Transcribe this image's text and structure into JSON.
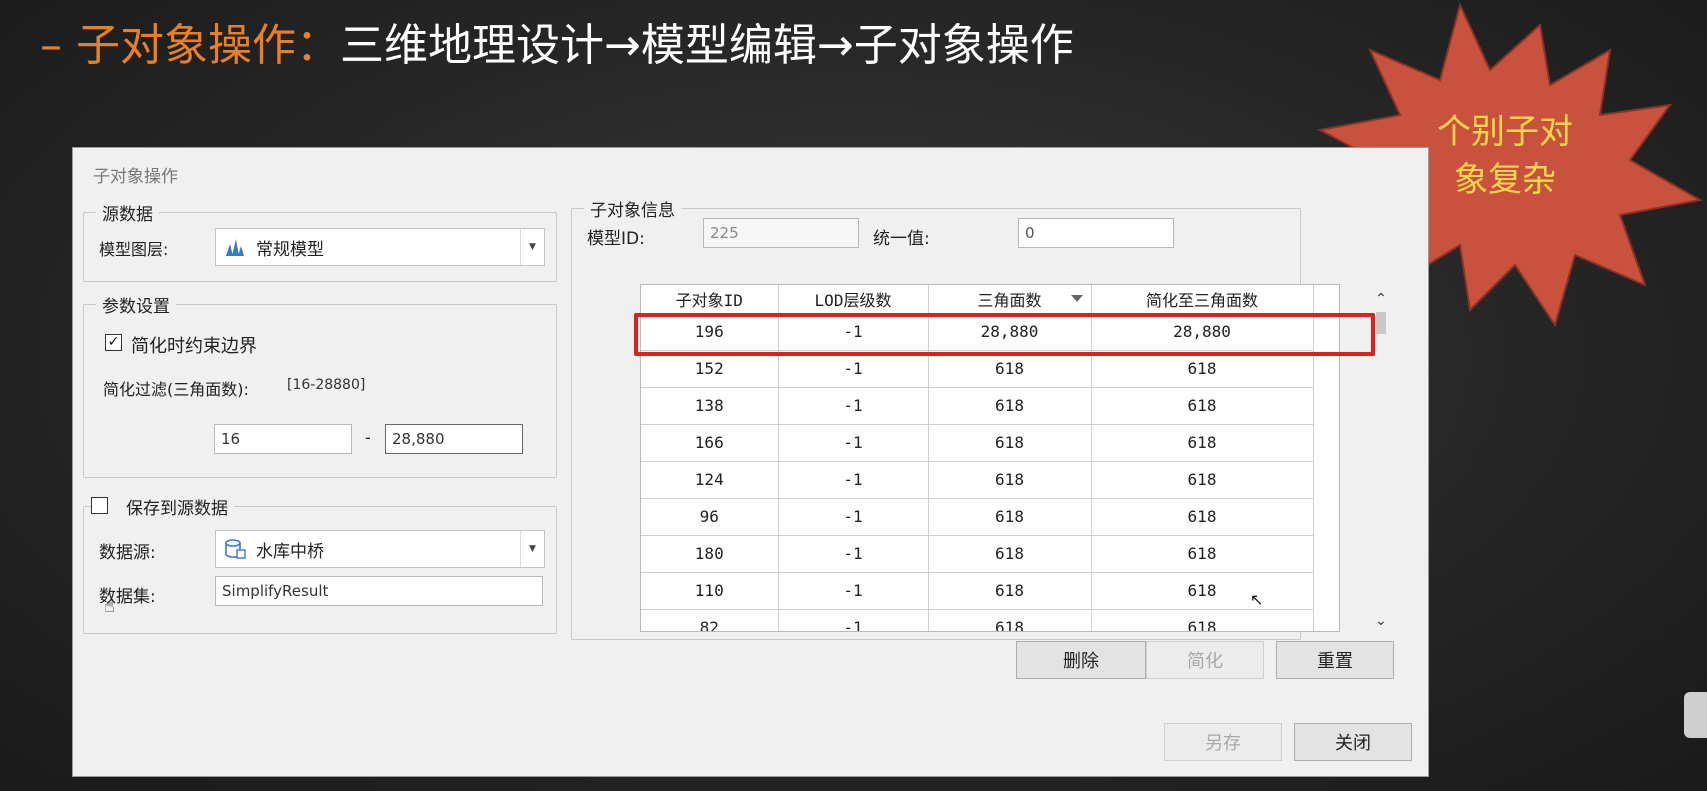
{
  "slide": {
    "title_highlight": "– 子对象操作：",
    "title_rest": "三维地理设计→模型编辑→子对象操作"
  },
  "callout": {
    "line1": "个别子对",
    "line2": "象复杂",
    "fill_color": "#c9523f",
    "text_color": "#ffd84a"
  },
  "dialog": {
    "title": "子对象操作",
    "source": {
      "legend": "源数据",
      "layer_label": "模型图层:",
      "layer_value": "常规模型",
      "layer_icon": "model-layer-icon"
    },
    "params": {
      "legend": "参数设置",
      "constrain_label": "简化时约束边界",
      "constrain_checked": true,
      "filter_label": "简化过滤(三角面数):",
      "filter_range": "[16-28880]",
      "min_value": "16",
      "separator": "-",
      "max_value": "28,880"
    },
    "save": {
      "legend": "保存到源数据",
      "checked": false,
      "datasource_label": "数据源:",
      "datasource_value": "水库中桥",
      "datasource_icon": "datasource-icon",
      "dataset_label": "数据集:",
      "dataset_value": "SimplifyResult"
    },
    "info": {
      "legend": "子对象信息",
      "model_id_label": "模型ID:",
      "model_id_value": "225",
      "unified_label": "统一值:",
      "unified_value": "0",
      "columns": [
        "子对象ID",
        "LOD层级数",
        "三角面数",
        "简化至三角面数"
      ],
      "rows": [
        [
          "196",
          "-1",
          "28,880",
          "28,880"
        ],
        [
          "152",
          "-1",
          "618",
          "618"
        ],
        [
          "138",
          "-1",
          "618",
          "618"
        ],
        [
          "166",
          "-1",
          "618",
          "618"
        ],
        [
          "124",
          "-1",
          "618",
          "618"
        ],
        [
          "96",
          "-1",
          "618",
          "618"
        ],
        [
          "180",
          "-1",
          "618",
          "618"
        ],
        [
          "110",
          "-1",
          "618",
          "618"
        ],
        [
          "82",
          "-1",
          "618",
          "618"
        ]
      ],
      "buttons": {
        "delete": "删除",
        "simplify": "简化",
        "reset": "重置"
      }
    },
    "footer": {
      "save_as": "另存",
      "close": "关闭"
    }
  }
}
